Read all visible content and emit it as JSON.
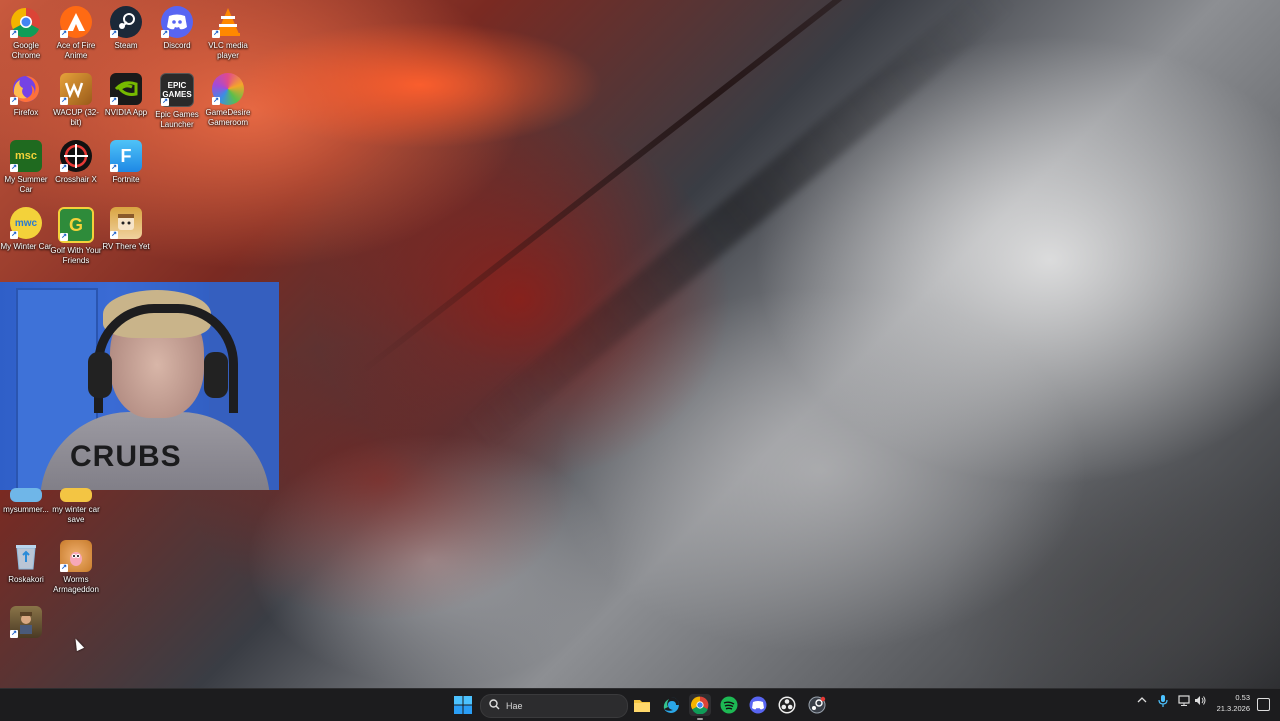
{
  "desktop": {
    "icons_row1": [
      {
        "label": "Google Chrome",
        "icon": "chrome-icon",
        "color": "#1a73e8"
      },
      {
        "label": "Ace of Fire Anime",
        "icon": "avast-icon",
        "color": "#ff6a13"
      },
      {
        "label": "Steam",
        "icon": "steam-icon",
        "color": "#1b2838"
      },
      {
        "label": "Discord",
        "icon": "discord-icon",
        "color": "#5865f2"
      },
      {
        "label": "VLC media player",
        "icon": "vlc-icon",
        "color": "#ff8800"
      }
    ],
    "icons_row2": [
      {
        "label": "Firefox",
        "icon": "firefox-icon",
        "color": "#ff7139"
      },
      {
        "label": "WACUP (32-bit)",
        "icon": "wacup-icon",
        "color": "#e6a23a"
      },
      {
        "label": "NVIDIA App",
        "icon": "nvidia-icon",
        "color": "#76b900"
      },
      {
        "label": "Epic Games Launcher",
        "icon": "epic-games-icon",
        "color": "#2a2a2a"
      },
      {
        "label": "GameDesire Gameroom",
        "icon": "gamedesire-icon",
        "color": "#e14a8c"
      }
    ],
    "icons_row3": [
      {
        "label": "My Summer Car",
        "icon": "msc-icon",
        "color": "#1f6a1f"
      },
      {
        "label": "Crosshair X",
        "icon": "crosshair-icon",
        "color": "#111111"
      },
      {
        "label": "Fortnite",
        "icon": "fortnite-icon",
        "color": "#3aa7e8"
      }
    ],
    "icons_row4": [
      {
        "label": "My Winter Car",
        "icon": "mwc-icon",
        "color": "#2a7ad1"
      },
      {
        "label": "Golf With Your Friends",
        "icon": "golf-icon",
        "color": "#2e8b3a"
      },
      {
        "label": "RV There Yet",
        "icon": "rv-icon",
        "color": "#d9a441"
      }
    ],
    "icons_lower": [
      {
        "label": "mysummer...",
        "icon": "folder-icon",
        "color": "#f3c543"
      },
      {
        "label": "my winter car save",
        "icon": "folder-icon",
        "color": "#f3c543"
      },
      {
        "label": "Roskakori",
        "icon": "recycle-bin-icon",
        "color": "#6fb6e8"
      },
      {
        "label": "Worms Armageddon",
        "icon": "worms-icon",
        "color": "#c77b2a"
      },
      {
        "label": "",
        "icon": "game-character-icon",
        "color": "#6b5a3a"
      }
    ]
  },
  "webcam": {
    "hoodie_text": "CRUBS"
  },
  "taskbar": {
    "search_placeholder": "Hae",
    "apps": [
      {
        "name": "file-explorer-icon",
        "color": "#f4c542"
      },
      {
        "name": "edge-icon",
        "color": "#2aa7e8"
      },
      {
        "name": "chrome-icon",
        "color": "#1a73e8"
      },
      {
        "name": "spotify-icon",
        "color": "#1db954"
      },
      {
        "name": "discord-icon",
        "color": "#5865f2"
      },
      {
        "name": "obs-icon",
        "color": "#cccccc"
      },
      {
        "name": "steam-icon",
        "color": "#9aa3ad"
      }
    ],
    "time": "0.53",
    "date": "21.3.2026"
  }
}
